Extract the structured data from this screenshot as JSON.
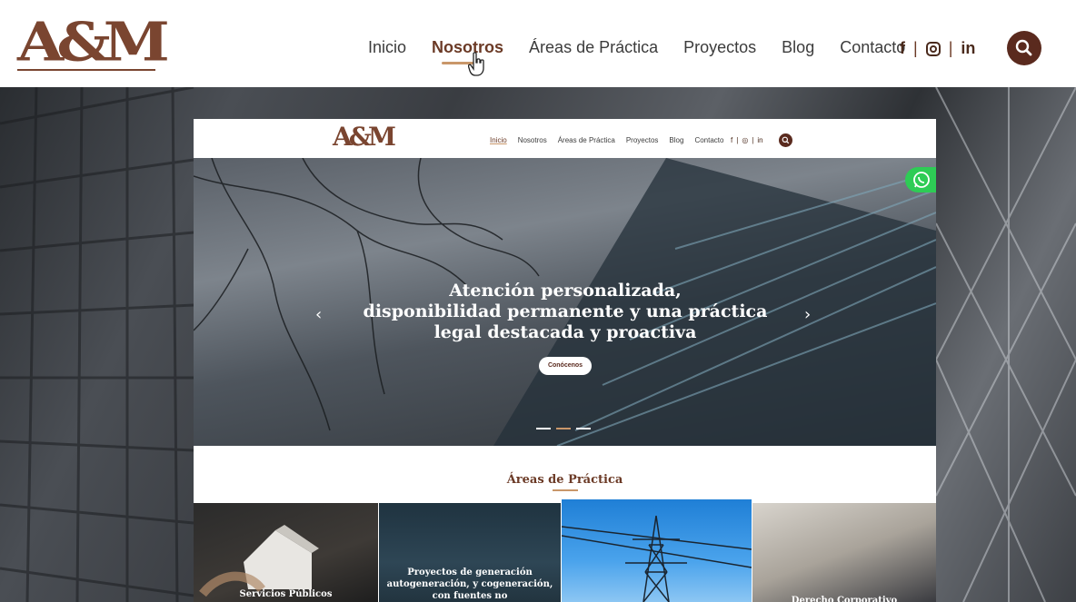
{
  "header": {
    "logo": "A&M",
    "nav": [
      "Inicio",
      "Nosotros",
      "Áreas de Práctica",
      "Proyectos",
      "Blog",
      "Contacto"
    ],
    "active_index": 1,
    "social": {
      "facebook": "f",
      "linkedin": "in",
      "separator": "|"
    }
  },
  "inner": {
    "logo": "A&M",
    "nav": [
      "Inicio",
      "Nosotros",
      "Áreas de Práctica",
      "Proyectos",
      "Blog",
      "Contacto"
    ],
    "active_index": 0,
    "social": {
      "facebook": "f",
      "instagram": "◎",
      "linkedin": "in",
      "separator": "|"
    },
    "hero": {
      "title_lines": [
        "Atención personalizada,",
        "disponibilidad permanente y una práctica",
        "legal destacada y proactiva"
      ],
      "button": "Conócenos",
      "prev": "‹",
      "next": "›",
      "slides": 3,
      "active_slide": 1
    },
    "areas": {
      "title": "Áreas de Práctica",
      "cards": [
        {
          "label": "Servicios Públicos"
        },
        {
          "label": "Proyectos de generación autogeneración, y cogeneración, con fuentes no"
        },
        {
          "label": ""
        },
        {
          "label": "Derecho Corporativo"
        }
      ]
    }
  },
  "colors": {
    "brand": "#7a4530",
    "brand_dark": "#5a2a1e",
    "accent": "#c9976a",
    "whatsapp": "#2ecc55"
  },
  "icons": [
    "cursor-hand-icon",
    "facebook-icon",
    "instagram-icon",
    "linkedin-icon",
    "search-icon",
    "whatsapp-icon",
    "chevron-left-icon",
    "chevron-right-icon"
  ]
}
